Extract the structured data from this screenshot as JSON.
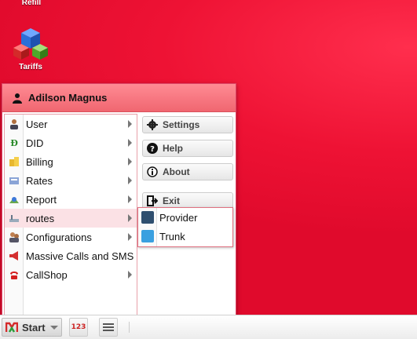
{
  "desktop": {
    "icons": [
      {
        "label": "Refill",
        "icon": "refill-icon"
      },
      {
        "label": "Tariffs",
        "icon": "tariffs-cubes-icon"
      }
    ]
  },
  "start_menu": {
    "user_name": "Adilson Magnus",
    "items": [
      {
        "label": "User",
        "icon": "user-icon",
        "has_submenu": true
      },
      {
        "label": "DID",
        "icon": "did-icon",
        "has_submenu": true
      },
      {
        "label": "Billing",
        "icon": "billing-coins-icon",
        "has_submenu": true
      },
      {
        "label": "Rates",
        "icon": "rates-icon",
        "has_submenu": true
      },
      {
        "label": "Report",
        "icon": "report-icon",
        "has_submenu": true
      },
      {
        "label": "routes",
        "icon": "routes-icon",
        "has_submenu": true,
        "highlighted": true
      },
      {
        "label": "Configurations",
        "icon": "configurations-icon",
        "has_submenu": true
      },
      {
        "label": "Massive Calls and SMS",
        "icon": "megaphone-icon",
        "has_submenu": false
      },
      {
        "label": "CallShop",
        "icon": "phone-icon",
        "has_submenu": true
      }
    ],
    "tools": [
      {
        "label": "Settings",
        "icon": "gear-icon"
      },
      {
        "label": "Help",
        "icon": "help-icon"
      },
      {
        "label": "About",
        "icon": "info-icon"
      },
      {
        "label": "Exit",
        "icon": "exit-icon"
      }
    ],
    "routes_submenu": [
      {
        "label": "Provider",
        "icon": "provider-icon"
      },
      {
        "label": "Trunk",
        "icon": "trunk-icon"
      }
    ]
  },
  "taskbar": {
    "start_label": "Start",
    "calc_label": "123"
  },
  "colors": {
    "desktop": "#e8102f",
    "header": "#f27a84",
    "highlight": "#fbe1e5"
  }
}
